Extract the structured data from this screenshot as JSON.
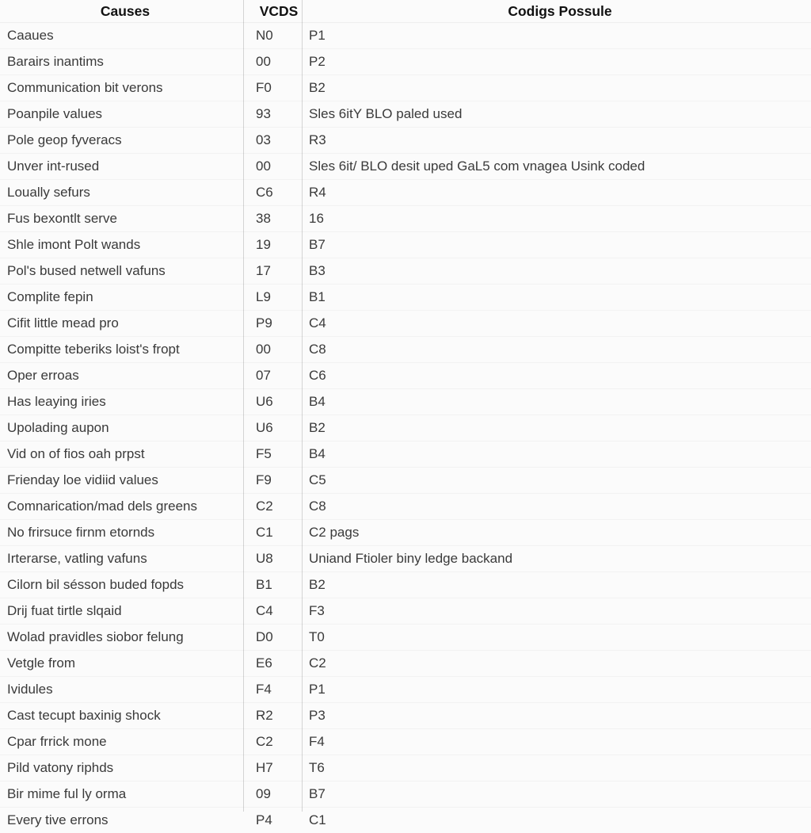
{
  "table": {
    "columns": [
      {
        "key": "cause",
        "label": "Causes"
      },
      {
        "key": "vcds",
        "label": "VCDS"
      },
      {
        "key": "code",
        "label": "Codigs Possule"
      }
    ],
    "rows": [
      {
        "cause": "Caaues",
        "vcds": "N0",
        "code": "P1"
      },
      {
        "cause": "Barairs inantims",
        "vcds": "00",
        "code": "P2"
      },
      {
        "cause": "Communication bit verons",
        "vcds": "F0",
        "code": "B2"
      },
      {
        "cause": "Poanpile values",
        "vcds": "93",
        "code": "Sles 6itY BLO paled used"
      },
      {
        "cause": "Pole geop fyveracs",
        "vcds": "03",
        "code": "R3"
      },
      {
        "cause": "Unver int-rused",
        "vcds": "00",
        "code": "Sles 6it/ BLO desit uped GaL5 com vnagea Usink coded"
      },
      {
        "cause": "Loually sefurs",
        "vcds": "C6",
        "code": "R4"
      },
      {
        "cause": "Fus bexontlt serve",
        "vcds": "38",
        "code": "16"
      },
      {
        "cause": "Shle imont Polt wands",
        "vcds": "19",
        "code": "B7"
      },
      {
        "cause": "Pol's bused netwell vafuns",
        "vcds": "17",
        "code": "B3"
      },
      {
        "cause": "Complite fepin",
        "vcds": "L9",
        "code": "B1"
      },
      {
        "cause": "Cifit little mead pro",
        "vcds": "P9",
        "code": "C4"
      },
      {
        "cause": "Compitte teberiks loist's fropt",
        "vcds": "00",
        "code": "C8"
      },
      {
        "cause": "Oper erroas",
        "vcds": "07",
        "code": "C6"
      },
      {
        "cause": "Has leaying iries",
        "vcds": "U6",
        "code": "B4"
      },
      {
        "cause": "Upolading aupon",
        "vcds": "U6",
        "code": "B2"
      },
      {
        "cause": "Vid on of fios oah prpst",
        "vcds": "F5",
        "code": "B4"
      },
      {
        "cause": "Frienday loe vidiid values",
        "vcds": "F9",
        "code": "C5"
      },
      {
        "cause": "Comnarication/mad dels greens",
        "vcds": "C2",
        "code": "C8"
      },
      {
        "cause": "No frirsuce firnm etornds",
        "vcds": "C1",
        "code": "C2 pags"
      },
      {
        "cause": "Irterarse, vatling vafuns",
        "vcds": "U8",
        "code": "Uniand Ftioler biny ledge backand"
      },
      {
        "cause": "Cilorn bil sésson buded fopds",
        "vcds": "B1",
        "code": "B2"
      },
      {
        "cause": "Drij fuat tirtle slqaid",
        "vcds": "C4",
        "code": "F3"
      },
      {
        "cause": "Wolad pravidles siobor felung",
        "vcds": "D0",
        "code": "T0"
      },
      {
        "cause": "Vetgle from",
        "vcds": "E6",
        "code": "C2"
      },
      {
        "cause": "Ividules",
        "vcds": "F4",
        "code": "P1"
      },
      {
        "cause": "Cast tecupt baxinig shock",
        "vcds": "R2",
        "code": "P3"
      },
      {
        "cause": "Cpar frrick mone",
        "vcds": "C2",
        "code": "F4"
      },
      {
        "cause": "Pild vatony riphds",
        "vcds": "H7",
        "code": "T6"
      },
      {
        "cause": "Bir mime ful ly orma",
        "vcds": "09",
        "code": "B7"
      },
      {
        "cause": "Every tive errons",
        "vcds": "P4",
        "code": "C1"
      }
    ]
  },
  "style": {
    "background": "#fbfbfb",
    "header_text": "#111111",
    "body_text": "#3a3a3a",
    "rule": "#d4d4d4"
  }
}
